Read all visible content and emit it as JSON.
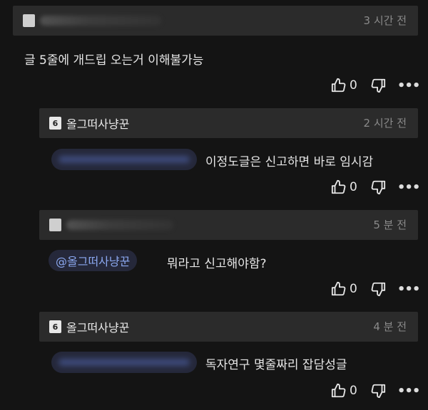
{
  "comments": [
    {
      "username": "",
      "time": "3 시간 전",
      "text": "글 5줄에 개드립 오는거 이해불가능",
      "mention": "",
      "likes": "0"
    },
    {
      "username": "올그떠사냥꾼",
      "level_badge": "6",
      "time": "2 시간 전",
      "text": "이정도글은 신고하면 바로 임시감",
      "mention": "",
      "likes": "0"
    },
    {
      "username": "",
      "time": "5 분 전",
      "text": "뭐라고 신고해야함?",
      "mention": "@올그떠사냥꾼",
      "likes": "0"
    },
    {
      "username": "올그떠사냥꾼",
      "level_badge": "6",
      "time": "4 분 전",
      "text": "독자연구 몇줄짜리 잡담성글",
      "mention": "",
      "likes": "0"
    }
  ],
  "icons": {
    "like": "thumbs-up-icon",
    "dislike": "thumbs-down-icon",
    "more": "more-options-icon"
  },
  "colors": {
    "background": "#141414",
    "header": "#2b2b2b",
    "mention_text": "#8ba8f0",
    "time": "#8a8a8a"
  }
}
